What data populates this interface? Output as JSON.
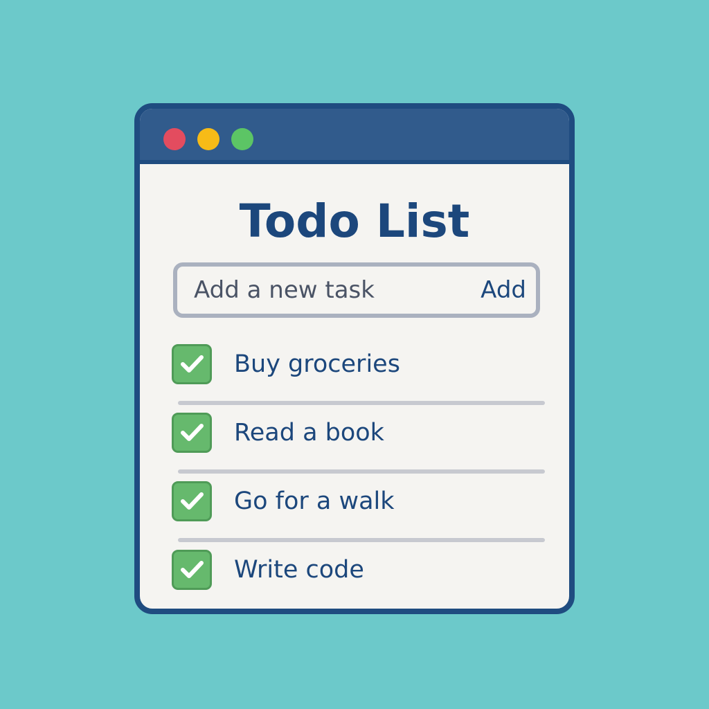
{
  "window": {
    "title": "Todo List"
  },
  "input": {
    "placeholder": "Add a new task",
    "value": "",
    "add_label": "Add"
  },
  "tasks": [
    {
      "label": "Buy groceries",
      "checked": true
    },
    {
      "label": "Read a book",
      "checked": true
    },
    {
      "label": "Go for a walk",
      "checked": true
    },
    {
      "label": "Write code",
      "checked": true
    }
  ],
  "icons": {
    "close": "close-dot-icon",
    "minimize": "minimize-dot-icon",
    "maximize": "maximize-dot-icon",
    "check": "checkmark-icon"
  },
  "colors": {
    "background": "#6cc9ca",
    "window_border": "#1f4c80",
    "titlebar": "#315b8c",
    "text": "#1c477c",
    "checkbox": "#66b96d",
    "close": "#e34c5f",
    "minimize": "#f7bb17",
    "maximize": "#5cc565"
  }
}
